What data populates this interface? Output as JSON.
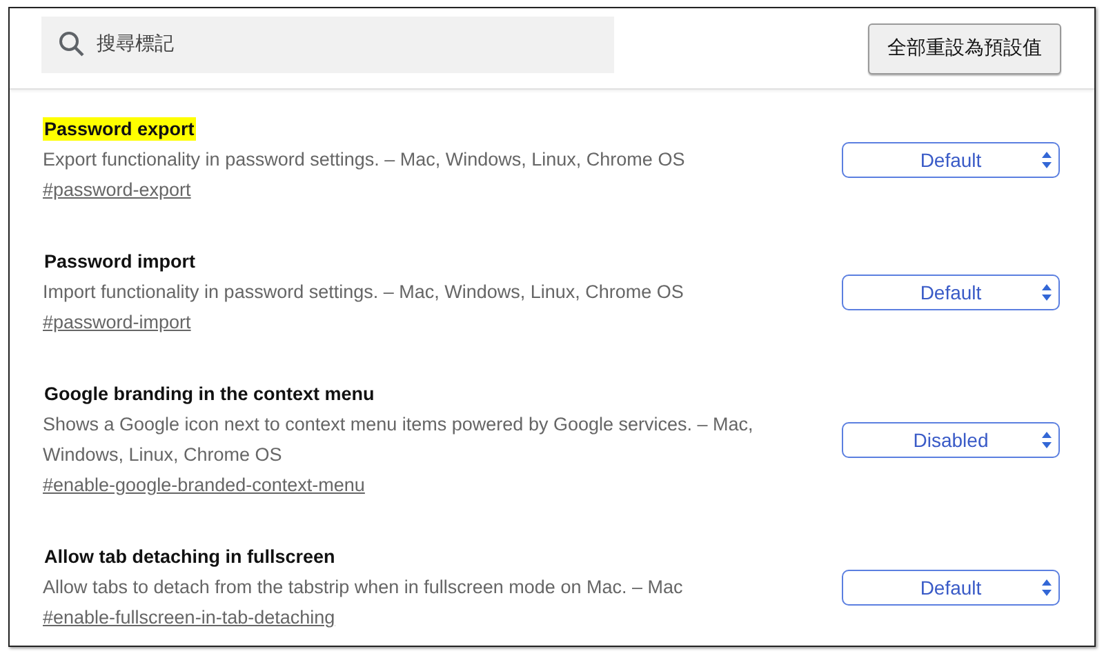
{
  "search": {
    "placeholder": "搜尋標記"
  },
  "reset_button": "全部重設為預設值",
  "flags": [
    {
      "title": "Password export",
      "highlighted": true,
      "description": "Export functionality in password settings. – Mac, Windows, Linux, Chrome OS",
      "link": "#password-export",
      "value": "Default"
    },
    {
      "title": "Password import",
      "highlighted": false,
      "description": "Import functionality in password settings. – Mac, Windows, Linux, Chrome OS",
      "link": "#password-import",
      "value": "Default"
    },
    {
      "title": "Google branding in the context menu",
      "highlighted": false,
      "description": "Shows a Google icon next to context menu items powered by Google services. – Mac, Windows, Linux, Chrome OS",
      "link": "#enable-google-branded-context-menu",
      "value": "Disabled"
    },
    {
      "title": "Allow tab detaching in fullscreen",
      "highlighted": false,
      "description": "Allow tabs to detach from the tabstrip when in fullscreen mode on Mac. – Mac",
      "link": "#enable-fullscreen-in-tab-detaching",
      "value": "Default"
    }
  ]
}
